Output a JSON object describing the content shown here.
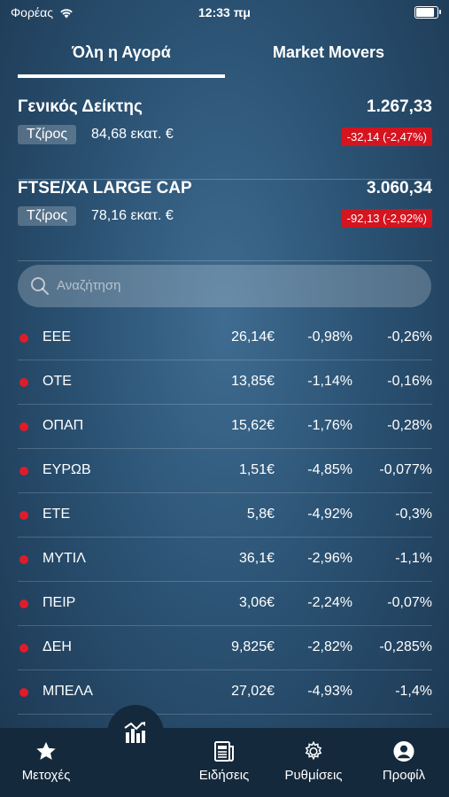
{
  "status": {
    "carrier": "Φορέας",
    "time": "12:33 πμ"
  },
  "tabs": [
    {
      "label": "Όλη η Αγορά",
      "active": true
    },
    {
      "label": "Market Movers",
      "active": false
    }
  ],
  "indices": [
    {
      "name": "Γενικός Δείκτης",
      "value": "1.267,33",
      "turnover_label": "Τζίρος",
      "turnover": "84,68 εκατ. €",
      "change": "-32,14 (-2,47%)"
    },
    {
      "name": "FTSE/XA LARGE CAP",
      "value": "3.060,34",
      "turnover_label": "Τζίρος",
      "turnover": "78,16 εκατ. €",
      "change": "-92,13 (-2,92%)"
    }
  ],
  "search": {
    "placeholder": "Αναζήτηση"
  },
  "stocks": [
    {
      "symbol": "ΕΕΕ",
      "price": "26,14€",
      "change": "-0,98%",
      "weight": "-0,26%"
    },
    {
      "symbol": "ΟΤΕ",
      "price": "13,85€",
      "change": "-1,14%",
      "weight": "-0,16%"
    },
    {
      "symbol": "ΟΠΑΠ",
      "price": "15,62€",
      "change": "-1,76%",
      "weight": "-0,28%"
    },
    {
      "symbol": "ΕΥΡΩΒ",
      "price": "1,51€",
      "change": "-4,85%",
      "weight": "-0,077%"
    },
    {
      "symbol": "ΕΤΕ",
      "price": "5,8€",
      "change": "-4,92%",
      "weight": "-0,3%"
    },
    {
      "symbol": "ΜΥΤΙΛ",
      "price": "36,1€",
      "change": "-2,96%",
      "weight": "-1,1%"
    },
    {
      "symbol": "ΠΕΙΡ",
      "price": "3,06€",
      "change": "-2,24%",
      "weight": "-0,07%"
    },
    {
      "symbol": "ΔΕΗ",
      "price": "9,825€",
      "change": "-2,82%",
      "weight": "-0,285%"
    },
    {
      "symbol": "ΜΠΕΛΑ",
      "price": "27,02€",
      "change": "-4,93%",
      "weight": "-1,4%"
    }
  ],
  "tabbar": [
    {
      "label": "Μετοχές",
      "icon": "star-icon"
    },
    {
      "label": "",
      "icon": "market-chart-icon"
    },
    {
      "label": "Ειδήσεις",
      "icon": "newspaper-icon"
    },
    {
      "label": "Ρυθμίσεις",
      "icon": "gear-icon"
    },
    {
      "label": "Προφίλ",
      "icon": "profile-icon"
    }
  ],
  "colors": {
    "negative": "#d4141f",
    "background": "#2b5273",
    "tabbar": "#15293c"
  }
}
